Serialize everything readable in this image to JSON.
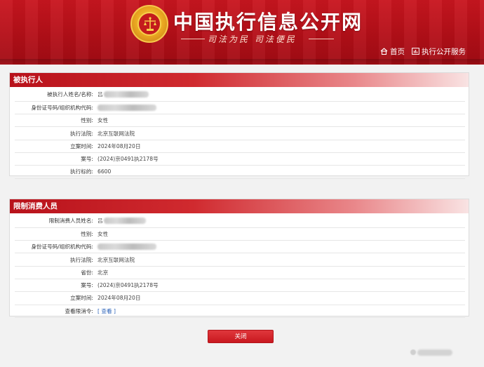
{
  "header": {
    "site_title": "中国执行信息公开网",
    "slogan": "司法为民  司法便民",
    "nav": [
      {
        "label": "首页",
        "icon": "home-icon"
      },
      {
        "label": "执行公开服务",
        "icon": "chart-icon"
      }
    ]
  },
  "executed_person": {
    "heading": "被执行人",
    "rows": [
      {
        "label": "被执行人姓名/名称:",
        "value": "吕"
      },
      {
        "label": "身份证号码/组织机构代码:",
        "value": ""
      },
      {
        "label": "性别:",
        "value": "女性"
      },
      {
        "label": "执行法院:",
        "value": "北京互联网法院"
      },
      {
        "label": "立案时间:",
        "value": "2024年08月20日"
      },
      {
        "label": "案号:",
        "value": "(2024)京0491执2178号"
      },
      {
        "label": "执行标的:",
        "value": "6600"
      }
    ]
  },
  "restricted_person": {
    "heading": "限制消费人员",
    "rows": [
      {
        "label": "限制消费人员姓名:",
        "value": "吕"
      },
      {
        "label": "性别:",
        "value": "女性"
      },
      {
        "label": "身份证号码/组织机构代码:",
        "value": ""
      },
      {
        "label": "执行法院:",
        "value": "北京互联网法院"
      },
      {
        "label": "省份:",
        "value": "北京"
      },
      {
        "label": "案号:",
        "value": "(2024)京0491执2178号"
      },
      {
        "label": "立案时间:",
        "value": "2024年08月20日"
      },
      {
        "label": "查看限消令:",
        "value": "[ 查看 ]"
      }
    ]
  },
  "close_button_label": "关闭",
  "colors": {
    "brand_red": "#c8181f",
    "link_blue": "#2a62b8"
  }
}
